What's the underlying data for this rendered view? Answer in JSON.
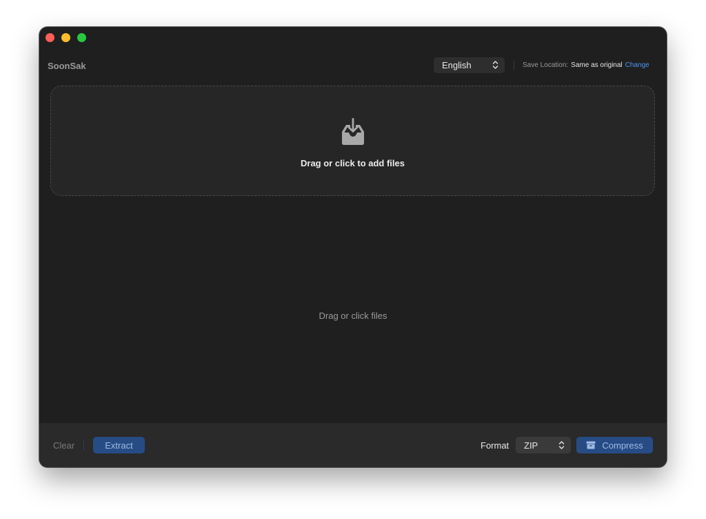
{
  "app": {
    "title": "SoonSak"
  },
  "header": {
    "language": "English",
    "save_location_label": "Save Location:",
    "save_location_value": "Same as original",
    "change_label": "Change"
  },
  "dropzone": {
    "icon": "tray-download-icon",
    "text": "Drag or click to add files"
  },
  "file_list": {
    "empty_text": "Drag or click files"
  },
  "footer": {
    "clear_label": "Clear",
    "extract_label": "Extract",
    "format_label": "Format",
    "format_value": "ZIP",
    "compress_label": "Compress",
    "compress_icon": "archive-box-icon"
  },
  "colors": {
    "window_bg": "#1f1f1f",
    "accent_button": "#274c85",
    "link": "#4c96f5"
  }
}
